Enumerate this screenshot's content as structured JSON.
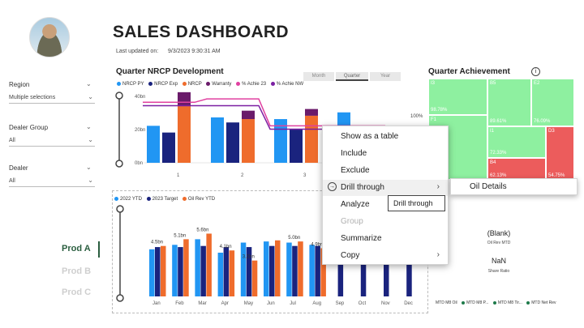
{
  "header": {
    "title": "SALES DASHBOARD",
    "last_updated_label": "Last updated on:",
    "last_updated_value": "9/3/2023 9:30:31 AM"
  },
  "slicers": [
    {
      "label": "Region",
      "value": "Multiple selections"
    },
    {
      "label": "Dealer Group",
      "value": "All"
    },
    {
      "label": "Dealer",
      "value": "All"
    }
  ],
  "products": [
    "Prod A",
    "Prod B",
    "Prod C"
  ],
  "top_chart": {
    "title": "Quarter NRCP Development",
    "tabs": [
      "Month",
      "Quarter",
      "Year"
    ],
    "legend": [
      "NRCP PY",
      "NRCP Exp",
      "NRCP",
      "Warranty",
      "% Achie 23",
      "% Achie NW"
    ],
    "yticks": [
      "40bn",
      "20bn",
      "0bn"
    ],
    "xticks": [
      "1",
      "2",
      "3"
    ],
    "pct_label": "100%"
  },
  "bottom_chart": {
    "legend": [
      "2022 YTD",
      "2023 Target",
      "Oil Rev YTD"
    ],
    "months": [
      "Jan",
      "Feb",
      "Mar",
      "Apr",
      "May",
      "Jun",
      "Jul",
      "Aug",
      "Sep",
      "Oct",
      "Nov",
      "Dec"
    ],
    "data_labels": [
      "4.5bn",
      "5.1bn",
      "5.6bn",
      "4.1bn",
      "3.2bn",
      "5.0bn",
      "4.9bn"
    ]
  },
  "treemap": {
    "title": "Quarter Achievement",
    "info_icon": "i",
    "labels": [
      "I3",
      "B5",
      "E2",
      "98.78%",
      "89.61%",
      "76.09%",
      "F1",
      "I1",
      "D3",
      "72.33%",
      "B4",
      "62.13%",
      "54.75%"
    ]
  },
  "context_menu": {
    "items": [
      {
        "label": "Show as a table",
        "enabled": true
      },
      {
        "label": "Include",
        "enabled": true
      },
      {
        "label": "Exclude",
        "enabled": true
      },
      {
        "label": "Drill through",
        "enabled": true
      },
      {
        "label": "Analyze",
        "enabled": true
      },
      {
        "label": "Group",
        "enabled": false
      },
      {
        "label": "Summarize",
        "enabled": true
      },
      {
        "label": "Copy",
        "enabled": true
      }
    ],
    "submenu_item": "Oil Details",
    "tooltip": "Drill through"
  },
  "kpis": [
    {
      "value": "(Blank)",
      "label": "Oil Rev MTD"
    },
    {
      "value": "NaN",
      "label": "Share Ratio"
    }
  ],
  "bottom_legend": [
    "MTD M8 Oil",
    "MTD M8 P...",
    "MTD M8 Tir...",
    "MTD Net Rev"
  ],
  "chart_data": [
    {
      "type": "bar",
      "categories": [
        "1",
        "2",
        "3",
        "4"
      ],
      "series": [
        {
          "name": "NRCP PY",
          "values": [
            22,
            27,
            26,
            30
          ]
        },
        {
          "name": "NRCP Exp",
          "values": [
            18,
            24,
            20,
            18
          ]
        },
        {
          "name": "NRCP",
          "values": [
            34,
            26,
            28,
            0
          ]
        },
        {
          "name": "Warranty",
          "values": [
            8,
            5,
            4,
            0
          ]
        },
        {
          "name": "% Achie 23",
          "values": [
            36,
            38,
            22,
            22
          ]
        },
        {
          "name": "% Achie NW",
          "values": [
            34,
            34,
            20,
            20
          ]
        }
      ],
      "ylim": [
        0,
        40
      ]
    },
    {
      "type": "bar",
      "categories": [
        "Jan",
        "Feb",
        "Mar",
        "Apr",
        "May",
        "Jun",
        "Jul",
        "Aug",
        "Sep",
        "Oct",
        "Nov",
        "Dec"
      ],
      "series": [
        {
          "name": "2022 YTD",
          "values": [
            4.2,
            4.6,
            5.1,
            3.9,
            4.8,
            4.9,
            4.8,
            4.6,
            0,
            0,
            0,
            0
          ]
        },
        {
          "name": "2023 Target",
          "values": [
            4.4,
            4.4,
            4.5,
            4.4,
            4.4,
            4.5,
            4.5,
            4.5,
            4.5,
            4.4,
            4.5,
            4.4
          ]
        },
        {
          "name": "Oil Rev YTD",
          "values": [
            4.5,
            5.1,
            5.6,
            4.1,
            3.2,
            5.0,
            4.9,
            4.3,
            0,
            0,
            0,
            0
          ]
        }
      ]
    }
  ]
}
